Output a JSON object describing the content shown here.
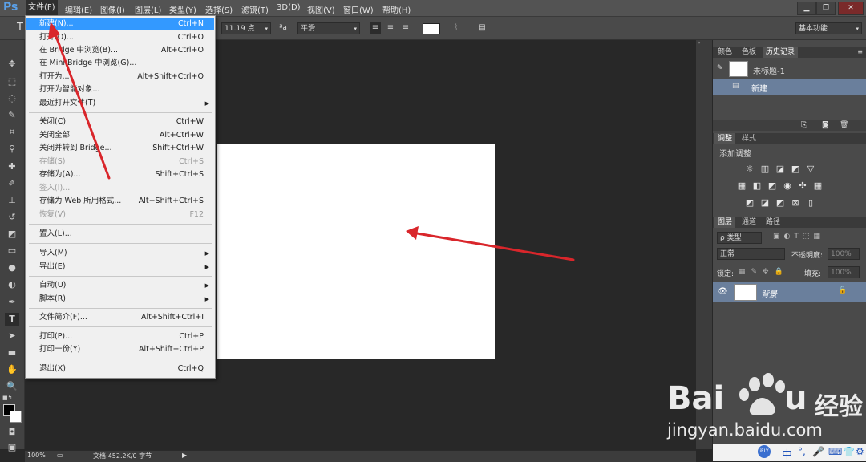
{
  "app": {
    "logo": "Ps"
  },
  "menubar": {
    "items": [
      "文件(F)",
      "编辑(E)",
      "图像(I)",
      "图层(L)",
      "类型(Y)",
      "选择(S)",
      "滤镜(T)",
      "3D(D)",
      "视图(V)",
      "窗口(W)",
      "帮助(H)"
    ],
    "window_buttons": [
      "▁",
      "❐",
      "✕"
    ]
  },
  "options": {
    "tool_glyph": "T",
    "font_size": "11.19 点",
    "aa_label": "ªa",
    "aa_mode": "平滑",
    "workspace": "基本功能"
  },
  "file_menu": {
    "items": [
      {
        "label": "新建(N)...",
        "shortcut": "Ctrl+N",
        "state": "highlight"
      },
      {
        "label": "打开(O)...",
        "shortcut": "Ctrl+O"
      },
      {
        "label": "在 Bridge 中浏览(B)...",
        "shortcut": "Alt+Ctrl+O"
      },
      {
        "label": "在 Mini Bridge 中浏览(G)...",
        "shortcut": ""
      },
      {
        "label": "打开为...",
        "shortcut": "Alt+Shift+Ctrl+O"
      },
      {
        "label": "打开为智能对象...",
        "shortcut": ""
      },
      {
        "label": "最近打开文件(T)",
        "shortcut": "",
        "submenu": true
      },
      {
        "sep": true
      },
      {
        "label": "关闭(C)",
        "shortcut": "Ctrl+W"
      },
      {
        "label": "关闭全部",
        "shortcut": "Alt+Ctrl+W"
      },
      {
        "label": "关闭并转到 Bridge...",
        "shortcut": "Shift+Ctrl+W"
      },
      {
        "label": "存储(S)",
        "shortcut": "Ctrl+S",
        "state": "disabled"
      },
      {
        "label": "存储为(A)...",
        "shortcut": "Shift+Ctrl+S"
      },
      {
        "label": "签入(I)...",
        "shortcut": "",
        "state": "disabled"
      },
      {
        "label": "存储为 Web 所用格式...",
        "shortcut": "Alt+Shift+Ctrl+S"
      },
      {
        "label": "恢复(V)",
        "shortcut": "F12",
        "state": "disabled"
      },
      {
        "sep": true
      },
      {
        "label": "置入(L)...",
        "shortcut": ""
      },
      {
        "sep": true
      },
      {
        "label": "导入(M)",
        "shortcut": "",
        "submenu": true
      },
      {
        "label": "导出(E)",
        "shortcut": "",
        "submenu": true
      },
      {
        "sep": true
      },
      {
        "label": "自动(U)",
        "shortcut": "",
        "submenu": true
      },
      {
        "label": "脚本(R)",
        "shortcut": "",
        "submenu": true
      },
      {
        "sep": true
      },
      {
        "label": "文件简介(F)...",
        "shortcut": "Alt+Shift+Ctrl+I"
      },
      {
        "sep": true
      },
      {
        "label": "打印(P)...",
        "shortcut": "Ctrl+P"
      },
      {
        "label": "打印一份(Y)",
        "shortcut": "Alt+Shift+Ctrl+P"
      },
      {
        "sep": true
      },
      {
        "label": "退出(X)",
        "shortcut": "Ctrl+Q"
      }
    ]
  },
  "history_panel": {
    "tabs": [
      "颜色",
      "色板",
      "历史记录"
    ],
    "active_tab": "历史记录",
    "snapshot": "未标题-1",
    "steps": [
      "新建"
    ]
  },
  "adjustments_panel": {
    "tabs": [
      "调整",
      "样式"
    ],
    "active_tab": "调整",
    "heading": "添加调整"
  },
  "layers_panel": {
    "tabs": [
      "图层",
      "通道",
      "路径"
    ],
    "active_tab": "图层",
    "filter_label": "ρ 类型",
    "blend_mode": "正常",
    "opacity_label": "不透明度:",
    "opacity_value": "100%",
    "lock_label": "锁定:",
    "fill_label": "填充:",
    "fill_value": "100%",
    "layers": [
      {
        "name": "背景",
        "locked": true,
        "visible": true
      }
    ]
  },
  "statusbar": {
    "zoom": "100%",
    "doc_info": "文档:452.2K/0 字节"
  },
  "watermark": {
    "brand": "Bai",
    "brand_end": "u",
    "product": "经验",
    "url": "jingyan.baidu.com"
  },
  "tray": {
    "items": [
      "中",
      "°,",
      "🎤",
      "⌨",
      "👕",
      "⚙"
    ]
  },
  "colors": {
    "menu_highlight": "#3399ff",
    "arrow": "#d9262b",
    "ps_blue": "#5aa0e8"
  }
}
